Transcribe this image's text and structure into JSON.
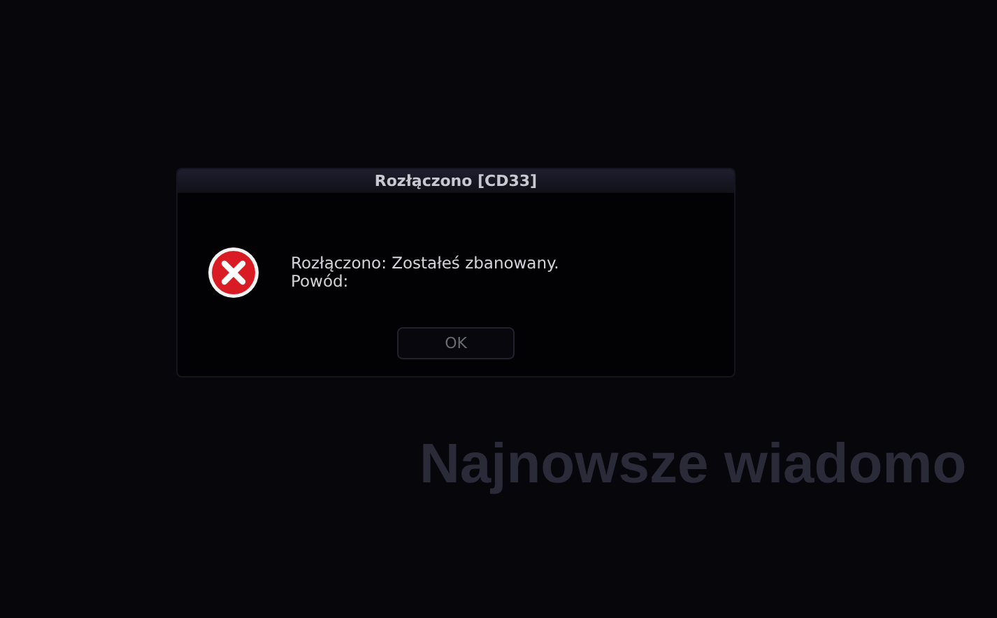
{
  "dialog": {
    "title": "Rozłączono [CD33]",
    "message": [
      "Rozłączono: Zostałeś zbanowany.",
      "Powód:"
    ],
    "buttons": [
      {
        "label": "OK",
        "disabled": true
      }
    ]
  },
  "background": {
    "heading": "Najnowsze wiadomo"
  }
}
